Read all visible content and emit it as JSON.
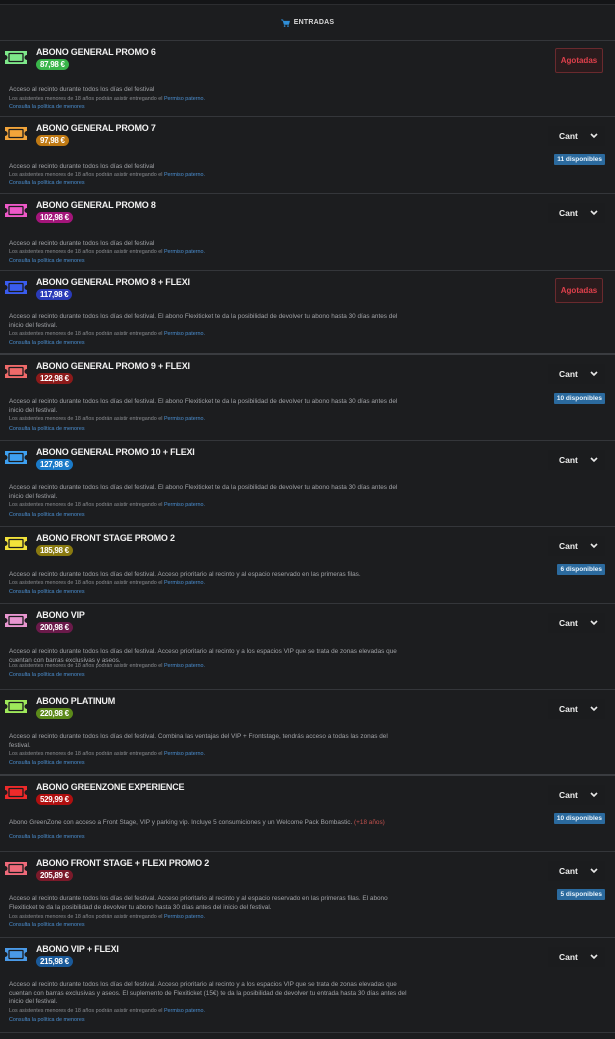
{
  "header": {
    "title": "ENTRADAS",
    "icon": "shopping-cart-icon",
    "accent": "#2f8fd8"
  },
  "common": {
    "minor_prefix": "Los asistentes menores de 18 años podrán asistir entregando el ",
    "minor_link": "Permiso paterno.",
    "policy": "Consulta la política de menores",
    "qty_label": "Cant",
    "sold_out": "Agotadas"
  },
  "tickets": [
    {
      "name": "ABONO GENERAL PROMO 6",
      "price": "87,98 €",
      "color": "#39b54a",
      "iconColor": "#7ee88a",
      "desc": "Acceso al recinto durante todos los días del festival",
      "status": "sold_out"
    },
    {
      "name": "ABONO GENERAL PROMO 7",
      "price": "97,98 €",
      "color": "#c07a14",
      "iconColor": "#f2a43a",
      "desc": "Acceso al recinto durante todos los días del festival",
      "status": "qty",
      "available": "11 disponibles"
    },
    {
      "name": "ABONO GENERAL PROMO 8",
      "price": "102,98 €",
      "color": "#a3157a",
      "iconColor": "#ee58c8",
      "desc": "Acceso al recinto durante todos los días del festival",
      "status": "qty"
    },
    {
      "name": "ABONO GENERAL PROMO 8 + FLEXI",
      "price": "117,98 €",
      "color": "#2a3bb8",
      "iconColor": "#3a5cee",
      "desc": "Acceso al recinto durante todos los días del festival. El abono Flexiticket te da la posibilidad de devolver tu abono hasta 30 días antes del inicio del festival.",
      "status": "sold_out"
    },
    {
      "name": "ABONO GENERAL PROMO 9 + FLEXI",
      "price": "122,98 €",
      "color": "#8c1a1a",
      "iconColor": "#ef6a6a",
      "desc": "Acceso al recinto durante todos los días del festival. El abono Flexiticket te da la posibilidad de devolver tu abono hasta 30 días antes del inicio del festival.",
      "status": "qty",
      "available": "10 disponibles"
    },
    {
      "name": "ABONO GENERAL PROMO 10 + FLEXI",
      "price": "127,98 €",
      "color": "#1a7ac8",
      "iconColor": "#3ea0f0",
      "desc": "Acceso al recinto durante todos los días del festival. El abono Flexiticket te da la posibilidad de devolver tu abono hasta 30 días antes del inicio del festival.",
      "status": "qty"
    },
    {
      "name": "ABONO FRONT STAGE PROMO 2",
      "price": "185,98 €",
      "color": "#8a7a10",
      "iconColor": "#f2e23a",
      "desc": "Acceso al recinto durante todos los días del festival. Acceso prioritario al recinto y al espacio reservado en las primeras filas.",
      "status": "qty",
      "available": "6 disponibles"
    },
    {
      "name": "ABONO VIP",
      "price": "200,98 €",
      "color": "#6a1a4a",
      "iconColor": "#e896d0",
      "desc": "Acceso al recinto durante todos los días del festival. Acceso prioritario al recinto y a los espacios VIP que se trata de zonas elevadas que cuentan con barras exclusivas y aseos.",
      "status": "qty"
    },
    {
      "name": "ABONO PLATINUM",
      "price": "220,98 €",
      "color": "#5c8a1a",
      "iconColor": "#9ee85a",
      "desc": "Acceso al recinto durante todos los días del festival. Combina las ventajas del VIP + Frontstage, tendrás acceso a todas las zonas del festival.",
      "status": "qty"
    },
    {
      "name": "ABONO GREENZONE EXPERIENCE",
      "price": "529,99 €",
      "color": "#b01010",
      "iconColor": "#ee2a2a",
      "desc": "Abono GreenZone con acceso a Front Stage, VIP y parking vip. Incluye 5 consumiciones y un Welcome Pack Bombastic.",
      "desc_warn": "(+18 años)",
      "status": "qty",
      "available": "10 disponibles"
    },
    {
      "name": "ABONO FRONT STAGE + FLEXI PROMO 2",
      "price": "205,89 €",
      "color": "#7a1a2a",
      "iconColor": "#ef6a7a",
      "desc": "Acceso al recinto durante todos los días del festival. Acceso prioritario al recinto y al espacio reservado en las primeras filas. El abono Flexiticket te da la posibilidad de devolver tu abono hasta 30 días antes del inicio del festival.",
      "status": "qty",
      "available": "5 disponibles"
    },
    {
      "name": "ABONO VIP + FLEXI",
      "price": "215,98 €",
      "color": "#1a5a9a",
      "iconColor": "#4a9ae8",
      "desc": "Acceso al recinto durante todos los días del festival. Acceso prioritario al recinto y a los espacios VIP que se trata de zonas elevadas que cuentan con barras exclusivas y aseos. El suplemento de Flexiticket (15€) te da la posibilidad de devolver tu entrada hasta 30 días antes del inicio del festival.",
      "status": "qty"
    }
  ]
}
